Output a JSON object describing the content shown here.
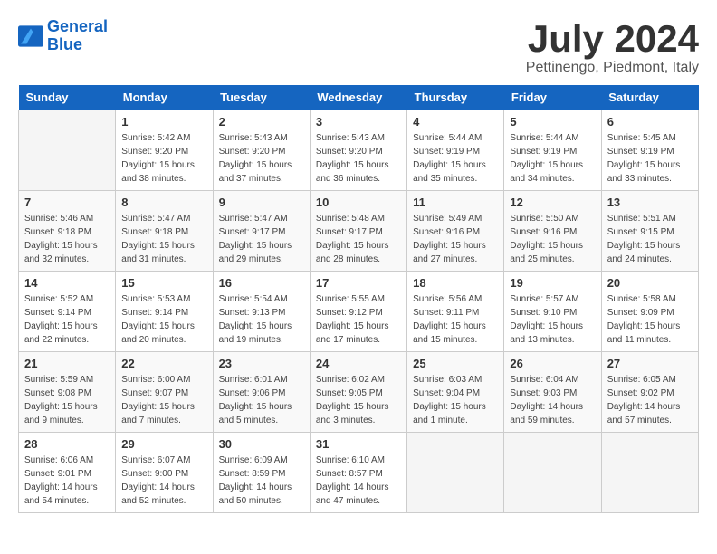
{
  "logo": {
    "line1": "General",
    "line2": "Blue"
  },
  "title": "July 2024",
  "subtitle": "Pettinengo, Piedmont, Italy",
  "weekdays": [
    "Sunday",
    "Monday",
    "Tuesday",
    "Wednesday",
    "Thursday",
    "Friday",
    "Saturday"
  ],
  "weeks": [
    [
      {
        "num": "",
        "empty": true
      },
      {
        "num": "1",
        "sunrise": "5:42 AM",
        "sunset": "9:20 PM",
        "daylight": "15 hours and 38 minutes."
      },
      {
        "num": "2",
        "sunrise": "5:43 AM",
        "sunset": "9:20 PM",
        "daylight": "15 hours and 37 minutes."
      },
      {
        "num": "3",
        "sunrise": "5:43 AM",
        "sunset": "9:20 PM",
        "daylight": "15 hours and 36 minutes."
      },
      {
        "num": "4",
        "sunrise": "5:44 AM",
        "sunset": "9:19 PM",
        "daylight": "15 hours and 35 minutes."
      },
      {
        "num": "5",
        "sunrise": "5:44 AM",
        "sunset": "9:19 PM",
        "daylight": "15 hours and 34 minutes."
      },
      {
        "num": "6",
        "sunrise": "5:45 AM",
        "sunset": "9:19 PM",
        "daylight": "15 hours and 33 minutes."
      }
    ],
    [
      {
        "num": "7",
        "sunrise": "5:46 AM",
        "sunset": "9:18 PM",
        "daylight": "15 hours and 32 minutes."
      },
      {
        "num": "8",
        "sunrise": "5:47 AM",
        "sunset": "9:18 PM",
        "daylight": "15 hours and 31 minutes."
      },
      {
        "num": "9",
        "sunrise": "5:47 AM",
        "sunset": "9:17 PM",
        "daylight": "15 hours and 29 minutes."
      },
      {
        "num": "10",
        "sunrise": "5:48 AM",
        "sunset": "9:17 PM",
        "daylight": "15 hours and 28 minutes."
      },
      {
        "num": "11",
        "sunrise": "5:49 AM",
        "sunset": "9:16 PM",
        "daylight": "15 hours and 27 minutes."
      },
      {
        "num": "12",
        "sunrise": "5:50 AM",
        "sunset": "9:16 PM",
        "daylight": "15 hours and 25 minutes."
      },
      {
        "num": "13",
        "sunrise": "5:51 AM",
        "sunset": "9:15 PM",
        "daylight": "15 hours and 24 minutes."
      }
    ],
    [
      {
        "num": "14",
        "sunrise": "5:52 AM",
        "sunset": "9:14 PM",
        "daylight": "15 hours and 22 minutes."
      },
      {
        "num": "15",
        "sunrise": "5:53 AM",
        "sunset": "9:14 PM",
        "daylight": "15 hours and 20 minutes."
      },
      {
        "num": "16",
        "sunrise": "5:54 AM",
        "sunset": "9:13 PM",
        "daylight": "15 hours and 19 minutes."
      },
      {
        "num": "17",
        "sunrise": "5:55 AM",
        "sunset": "9:12 PM",
        "daylight": "15 hours and 17 minutes."
      },
      {
        "num": "18",
        "sunrise": "5:56 AM",
        "sunset": "9:11 PM",
        "daylight": "15 hours and 15 minutes."
      },
      {
        "num": "19",
        "sunrise": "5:57 AM",
        "sunset": "9:10 PM",
        "daylight": "15 hours and 13 minutes."
      },
      {
        "num": "20",
        "sunrise": "5:58 AM",
        "sunset": "9:09 PM",
        "daylight": "15 hours and 11 minutes."
      }
    ],
    [
      {
        "num": "21",
        "sunrise": "5:59 AM",
        "sunset": "9:08 PM",
        "daylight": "15 hours and 9 minutes."
      },
      {
        "num": "22",
        "sunrise": "6:00 AM",
        "sunset": "9:07 PM",
        "daylight": "15 hours and 7 minutes."
      },
      {
        "num": "23",
        "sunrise": "6:01 AM",
        "sunset": "9:06 PM",
        "daylight": "15 hours and 5 minutes."
      },
      {
        "num": "24",
        "sunrise": "6:02 AM",
        "sunset": "9:05 PM",
        "daylight": "15 hours and 3 minutes."
      },
      {
        "num": "25",
        "sunrise": "6:03 AM",
        "sunset": "9:04 PM",
        "daylight": "15 hours and 1 minute."
      },
      {
        "num": "26",
        "sunrise": "6:04 AM",
        "sunset": "9:03 PM",
        "daylight": "14 hours and 59 minutes."
      },
      {
        "num": "27",
        "sunrise": "6:05 AM",
        "sunset": "9:02 PM",
        "daylight": "14 hours and 57 minutes."
      }
    ],
    [
      {
        "num": "28",
        "sunrise": "6:06 AM",
        "sunset": "9:01 PM",
        "daylight": "14 hours and 54 minutes."
      },
      {
        "num": "29",
        "sunrise": "6:07 AM",
        "sunset": "9:00 PM",
        "daylight": "14 hours and 52 minutes."
      },
      {
        "num": "30",
        "sunrise": "6:09 AM",
        "sunset": "8:59 PM",
        "daylight": "14 hours and 50 minutes."
      },
      {
        "num": "31",
        "sunrise": "6:10 AM",
        "sunset": "8:57 PM",
        "daylight": "14 hours and 47 minutes."
      },
      {
        "num": "",
        "empty": true
      },
      {
        "num": "",
        "empty": true
      },
      {
        "num": "",
        "empty": true
      }
    ]
  ]
}
